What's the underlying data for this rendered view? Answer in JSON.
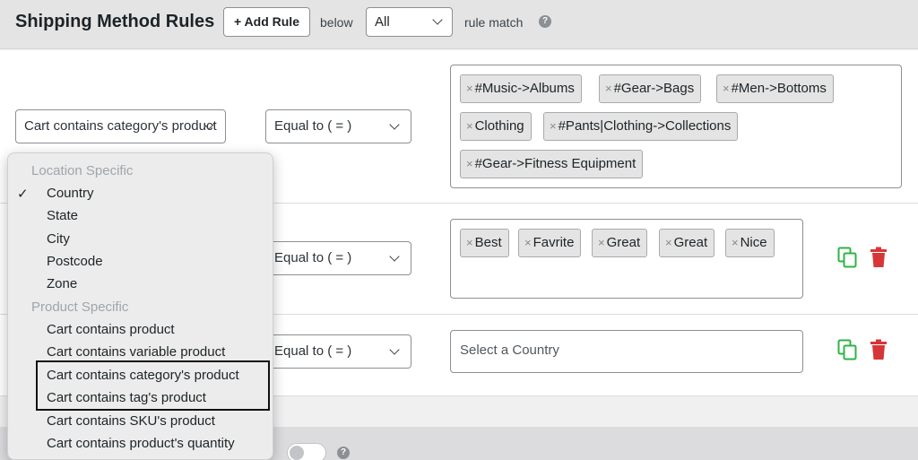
{
  "header": {
    "title": "Shipping Method Rules",
    "add_rule_label": "+ Add Rule",
    "below_label": "below",
    "match_value": "All",
    "rule_match_label": "rule match",
    "help_glyph": "?"
  },
  "rules": [
    {
      "condition": "Cart contains category's product",
      "operator": "Equal to ( = )",
      "tags": [
        "#Music->Albums",
        "#Gear->Bags",
        "#Men->Bottoms",
        "Clothing",
        "#Pants|Clothing->Collections",
        "#Gear->Fitness Equipment"
      ]
    },
    {
      "operator": "Equal to ( = )",
      "tags": [
        "Best",
        "Favrite",
        "Great",
        "Great",
        "Nice"
      ]
    },
    {
      "operator": "Equal to ( = )",
      "placeholder": "Select a Country"
    }
  ],
  "dropdown": {
    "groups": [
      {
        "label": "Location Specific",
        "items": [
          "Country",
          "State",
          "City",
          "Postcode",
          "Zone"
        ]
      },
      {
        "label": "Product Specific",
        "items": [
          "Cart contains product",
          "Cart contains variable product",
          "Cart contains category's product",
          "Cart contains tag's product",
          "Cart contains SKU's product",
          "Cart contains product's quantity"
        ]
      }
    ],
    "checked_item": "Country",
    "check_glyph": "✓"
  },
  "icon_glyphs": {
    "remove_tag": "×"
  },
  "colors": {
    "copy_icon": "#2fb344",
    "trash_icon": "#d63638"
  }
}
